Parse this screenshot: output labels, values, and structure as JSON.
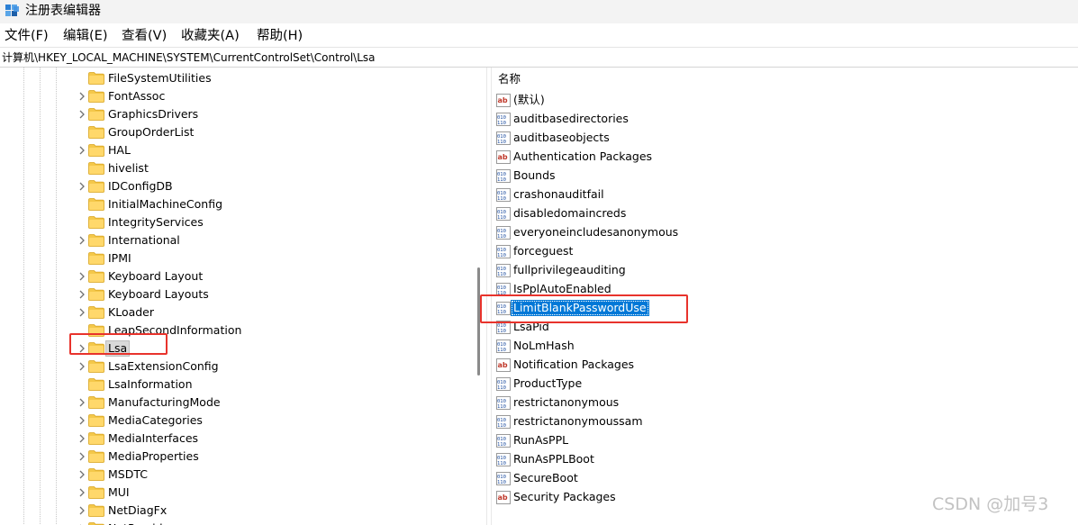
{
  "window": {
    "title": "注册表编辑器",
    "icon": "regedit-icon"
  },
  "menu": [
    "文件(F)",
    "编辑(E)",
    "查看(V)",
    "收藏夹(A)",
    "帮助(H)"
  ],
  "address": "计算机\\HKEY_LOCAL_MACHINE\\SYSTEM\\CurrentControlSet\\Control\\Lsa",
  "tree": {
    "items": [
      {
        "label": "FileSystemUtilities",
        "expandable": false
      },
      {
        "label": "FontAssoc",
        "expandable": true
      },
      {
        "label": "GraphicsDrivers",
        "expandable": true
      },
      {
        "label": "GroupOrderList",
        "expandable": false
      },
      {
        "label": "HAL",
        "expandable": true
      },
      {
        "label": "hivelist",
        "expandable": false
      },
      {
        "label": "IDConfigDB",
        "expandable": true
      },
      {
        "label": "InitialMachineConfig",
        "expandable": false
      },
      {
        "label": "IntegrityServices",
        "expandable": false
      },
      {
        "label": "International",
        "expandable": true
      },
      {
        "label": "IPMI",
        "expandable": false
      },
      {
        "label": "Keyboard Layout",
        "expandable": true
      },
      {
        "label": "Keyboard Layouts",
        "expandable": true
      },
      {
        "label": "KLoader",
        "expandable": true
      },
      {
        "label": "LeapSecondInformation",
        "expandable": false
      },
      {
        "label": "Lsa",
        "expandable": true,
        "selected": true
      },
      {
        "label": "LsaExtensionConfig",
        "expandable": true
      },
      {
        "label": "LsaInformation",
        "expandable": false
      },
      {
        "label": "ManufacturingMode",
        "expandable": true
      },
      {
        "label": "MediaCategories",
        "expandable": true
      },
      {
        "label": "MediaInterfaces",
        "expandable": true
      },
      {
        "label": "MediaProperties",
        "expandable": true
      },
      {
        "label": "MSDTC",
        "expandable": true
      },
      {
        "label": "MUI",
        "expandable": true
      },
      {
        "label": "NetDiagFx",
        "expandable": true
      },
      {
        "label": "NetProvider",
        "expandable": true
      }
    ]
  },
  "values": {
    "column_header": "名称",
    "items": [
      {
        "name": "(默认)",
        "type": "string"
      },
      {
        "name": "auditbasedirectories",
        "type": "binary"
      },
      {
        "name": "auditbaseobjects",
        "type": "binary"
      },
      {
        "name": "Authentication Packages",
        "type": "string"
      },
      {
        "name": "Bounds",
        "type": "binary"
      },
      {
        "name": "crashonauditfail",
        "type": "binary"
      },
      {
        "name": "disabledomaincreds",
        "type": "binary"
      },
      {
        "name": "everyoneincludesanonymous",
        "type": "binary"
      },
      {
        "name": "forceguest",
        "type": "binary"
      },
      {
        "name": "fullprivilegeauditing",
        "type": "binary"
      },
      {
        "name": "IsPplAutoEnabled",
        "type": "binary"
      },
      {
        "name": "LimitBlankPasswordUse",
        "type": "binary",
        "selected": true
      },
      {
        "name": "LsaPid",
        "type": "binary"
      },
      {
        "name": "NoLmHash",
        "type": "binary"
      },
      {
        "name": "Notification Packages",
        "type": "string"
      },
      {
        "name": "ProductType",
        "type": "binary"
      },
      {
        "name": "restrictanonymous",
        "type": "binary"
      },
      {
        "name": "restrictanonymoussam",
        "type": "binary"
      },
      {
        "name": "RunAsPPL",
        "type": "binary"
      },
      {
        "name": "RunAsPPLBoot",
        "type": "binary"
      },
      {
        "name": "SecureBoot",
        "type": "binary"
      },
      {
        "name": "Security Packages",
        "type": "string"
      }
    ]
  },
  "colors": {
    "selection": "#0078d7",
    "annotation": "#e8332c",
    "folder": "#f4c84a"
  },
  "watermark": "CSDN @加号3"
}
